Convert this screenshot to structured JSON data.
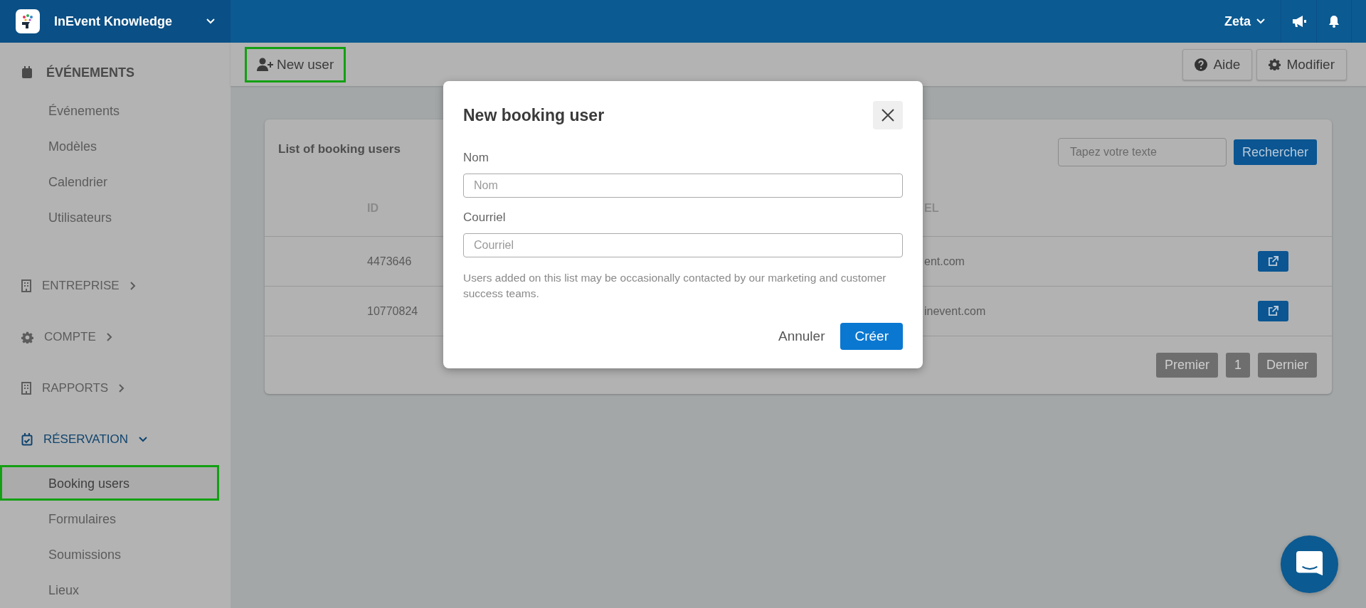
{
  "app": {
    "title": "InEvent Knowledge"
  },
  "topbar": {
    "user": "Zeta"
  },
  "sidebar": {
    "sections": [
      {
        "kind": "heading",
        "label": "ÉVÉNEMENTS",
        "items": [
          {
            "label": "Événements",
            "selected": false,
            "outlined": false
          },
          {
            "label": "Modèles",
            "selected": false,
            "outlined": false
          },
          {
            "label": "Calendrier",
            "selected": false,
            "outlined": false
          },
          {
            "label": "Utilisateurs",
            "selected": false,
            "outlined": false
          }
        ]
      },
      {
        "kind": "group",
        "label": "ENTREPRISE",
        "selected": false,
        "expanded": false
      },
      {
        "kind": "group",
        "label": "COMPTE",
        "selected": false,
        "expanded": false
      },
      {
        "kind": "group",
        "label": "RAPPORTS",
        "selected": false,
        "expanded": false
      },
      {
        "kind": "group",
        "label": "RÉSERVATION",
        "selected": true,
        "expanded": true,
        "items": [
          {
            "label": "Booking users",
            "selected": true,
            "outlined": true
          },
          {
            "label": "Formulaires",
            "selected": false,
            "outlined": false
          },
          {
            "label": "Soumissions",
            "selected": false,
            "outlined": false
          },
          {
            "label": "Lieux",
            "selected": false,
            "outlined": false
          }
        ]
      }
    ]
  },
  "toolbar": {
    "new_user": {
      "label": "New user",
      "outlined": true
    },
    "help": "Aide",
    "edit": "Modifier"
  },
  "card": {
    "title": "List of booking users",
    "search": {
      "placeholder": "Tapez votre texte",
      "button": "Rechercher"
    },
    "columns": [
      "ID",
      "EL"
    ],
    "rows": [
      {
        "id": "4473646",
        "column_3": "ent.com"
      },
      {
        "id": "10770824",
        "column_3": "inevent.com"
      }
    ],
    "pagination": [
      {
        "label": "Premier",
        "disabled": true
      },
      {
        "label": "1",
        "disabled": true
      },
      {
        "label": "Dernier",
        "disabled": true
      }
    ]
  },
  "modal": {
    "title": "New booking user",
    "fields": [
      {
        "label": "Nom",
        "placeholder": "Nom"
      },
      {
        "label": "Courriel",
        "placeholder": "Courriel"
      }
    ],
    "note": "Users added on this list may be occasionally contacted by our marketing and customer success teams.",
    "cancel": "Annuler",
    "submit": "Créer"
  }
}
